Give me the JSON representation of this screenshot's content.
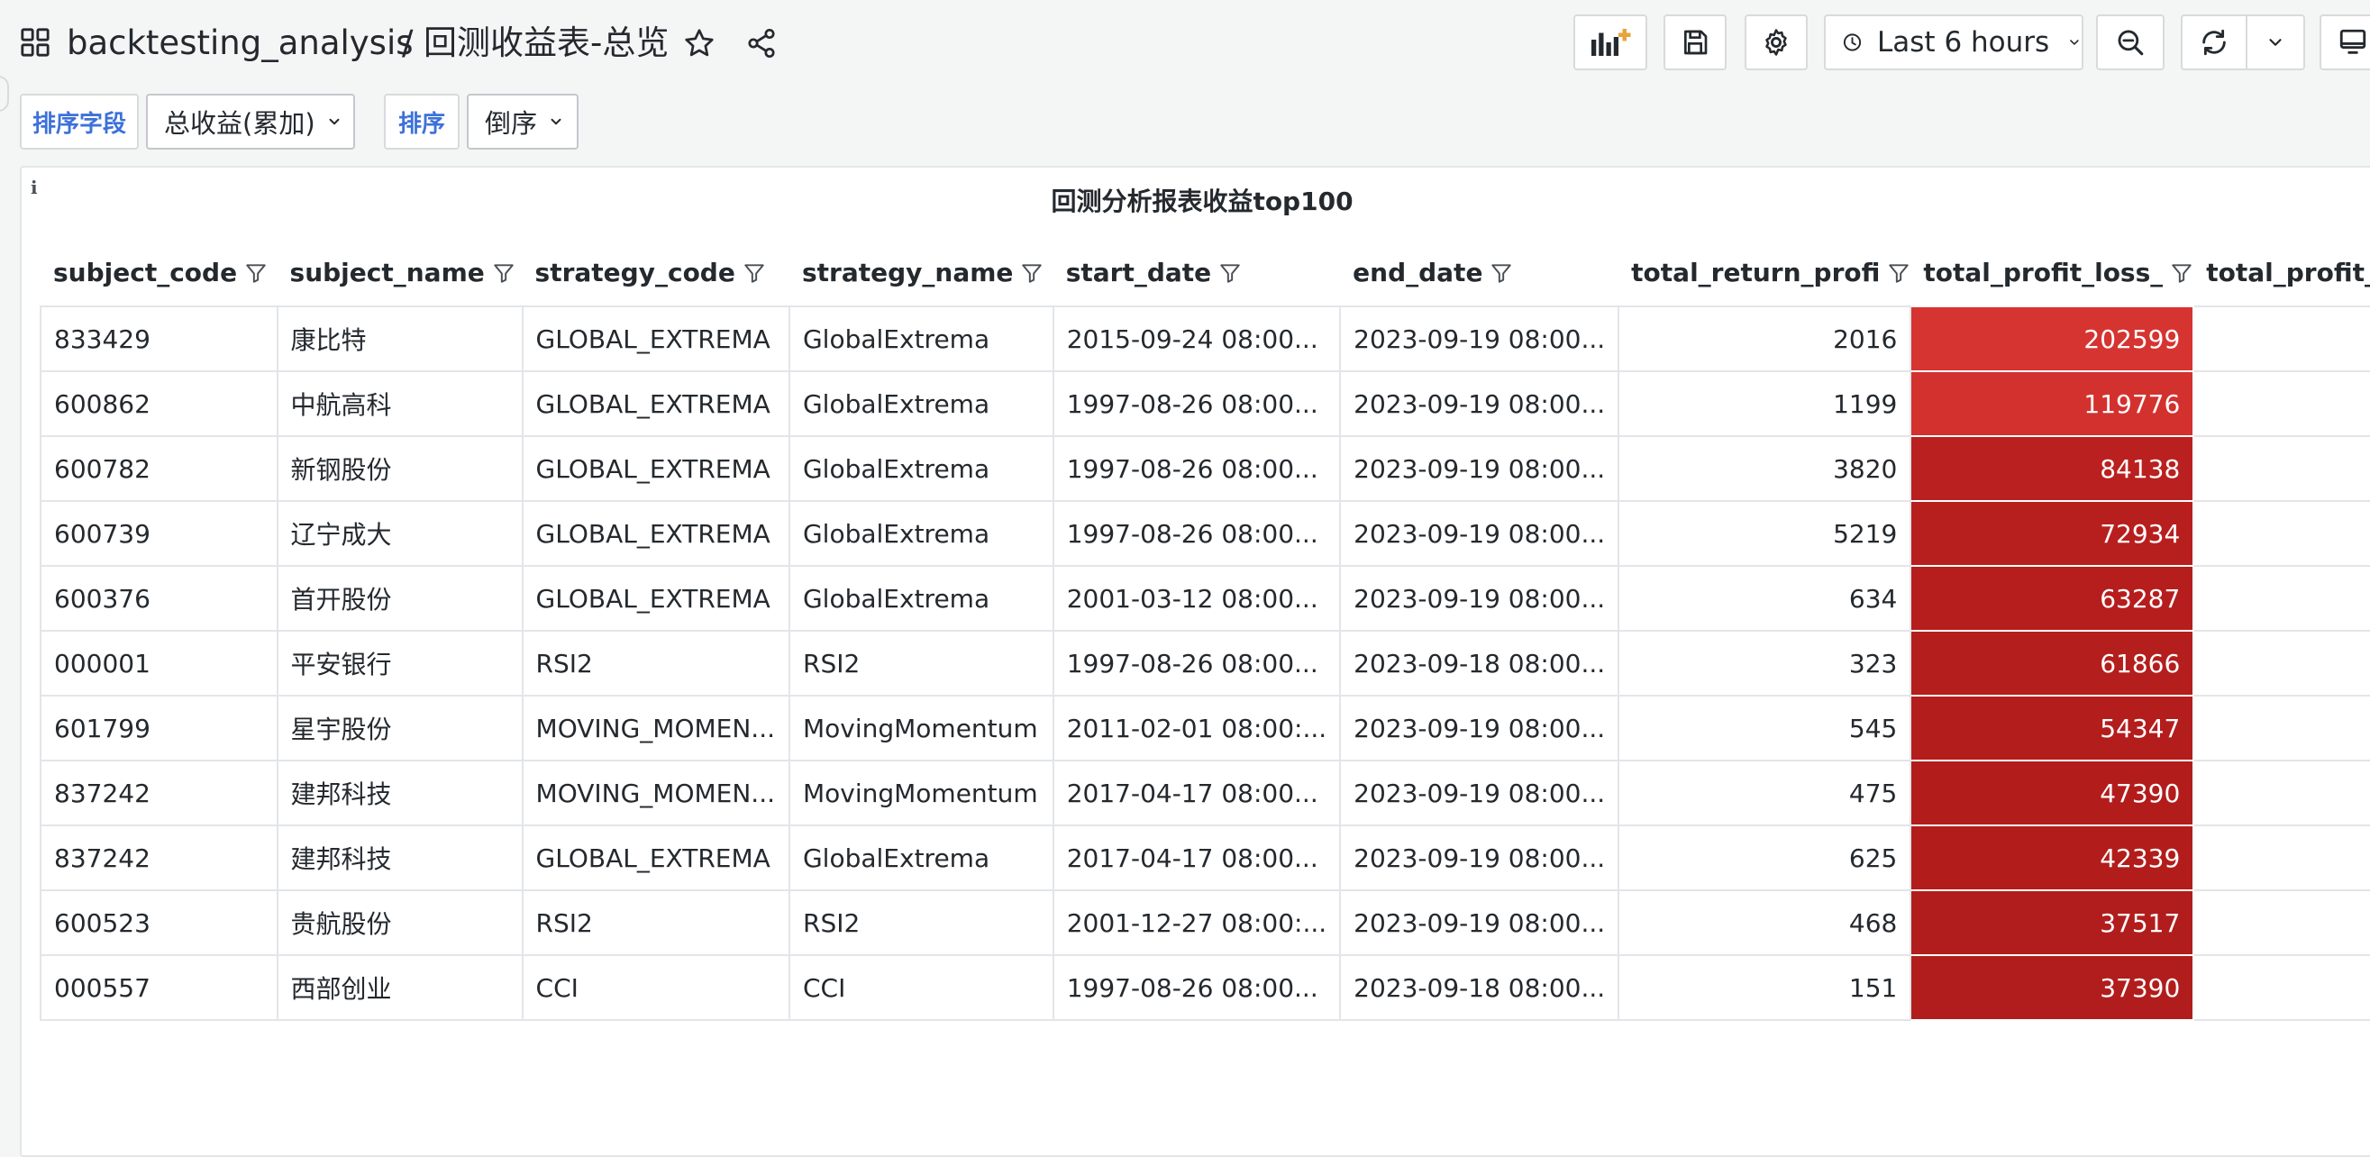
{
  "header": {
    "folder": "backtesting_analysis",
    "separator": "/",
    "title": "回测收益表-总览",
    "time_range": "Last 6 hours"
  },
  "variables": {
    "sort_field_label": "排序字段",
    "sort_field_value": "总收益(累加)",
    "sort_label": "排序",
    "sort_value": "倒序"
  },
  "panel": {
    "info_glyph": "i",
    "title": "回测分析报表收益top100"
  },
  "table": {
    "columns": [
      "subject_code",
      "subject_name",
      "strategy_code",
      "strategy_name",
      "start_date",
      "end_date",
      "total_return_profi",
      "total_profit_loss_",
      "total_profit_"
    ],
    "rows": [
      [
        "833429",
        "康比特",
        "GLOBAL_EXTREMA",
        "GlobalExtrema",
        "2015-09-24 08:00...",
        "2023-09-19 08:00...",
        "2016",
        "202599"
      ],
      [
        "600862",
        "中航高科",
        "GLOBAL_EXTREMA",
        "GlobalExtrema",
        "1997-08-26 08:00...",
        "2023-09-19 08:00...",
        "1199",
        "119776"
      ],
      [
        "600782",
        "新钢股份",
        "GLOBAL_EXTREMA",
        "GlobalExtrema",
        "1997-08-26 08:00...",
        "2023-09-19 08:00...",
        "3820",
        "84138"
      ],
      [
        "600739",
        "辽宁成大",
        "GLOBAL_EXTREMA",
        "GlobalExtrema",
        "1997-08-26 08:00...",
        "2023-09-19 08:00...",
        "5219",
        "72934"
      ],
      [
        "600376",
        "首开股份",
        "GLOBAL_EXTREMA",
        "GlobalExtrema",
        "2001-03-12 08:00...",
        "2023-09-19 08:00...",
        "634",
        "63287"
      ],
      [
        "000001",
        "平安银行",
        "RSI2",
        "RSI2",
        "1997-08-26 08:00...",
        "2023-09-18 08:00...",
        "323",
        "61866"
      ],
      [
        "601799",
        "星宇股份",
        "MOVING_MOMEN...",
        "MovingMomentum",
        "2011-02-01 08:00:...",
        "2023-09-19 08:00...",
        "545",
        "54347"
      ],
      [
        "837242",
        "建邦科技",
        "MOVING_MOMEN...",
        "MovingMomentum",
        "2017-04-17 08:00...",
        "2023-09-19 08:00...",
        "475",
        "47390"
      ],
      [
        "837242",
        "建邦科技",
        "GLOBAL_EXTREMA",
        "GlobalExtrema",
        "2017-04-17 08:00...",
        "2023-09-19 08:00...",
        "625",
        "42339"
      ],
      [
        "600523",
        "贵航股份",
        "RSI2",
        "RSI2",
        "2001-12-27 08:00:...",
        "2023-09-19 08:00...",
        "468",
        "37517"
      ],
      [
        "000557",
        "西部创业",
        "CCI",
        "CCI",
        "1997-08-26 08:00...",
        "2023-09-18 08:00...",
        "151",
        "37390"
      ]
    ],
    "heat_colors": [
      "#d63431",
      "#d3312e",
      "#b9201f",
      "#b71f1e",
      "#b51e1d",
      "#b41e1d",
      "#b31d1c",
      "#b21d1c",
      "#b21d1c",
      "#b11d1c",
      "#b11d1c"
    ]
  },
  "colors": {
    "link_blue": "#3d71d9",
    "background": "#f4f5f5"
  }
}
